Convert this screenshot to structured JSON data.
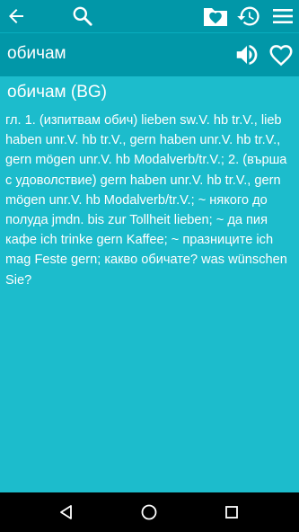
{
  "toolbar": {
    "back_icon": "arrow-left-icon",
    "search_icon": "search-icon",
    "favorites_folder_icon": "favorite-folder-icon",
    "history_icon": "history-icon",
    "menu_icon": "menu-icon"
  },
  "word_bar": {
    "title": "обичам",
    "speaker_icon": "speaker-icon",
    "favorite_icon": "heart-outline-icon"
  },
  "entry": {
    "heading": "обичам (BG)",
    "body": "гл. 1. (изпитвам обич) lieben sw.V. hb tr.V., lieb haben unr.V. hb tr.V., gern haben unr.V. hb tr.V., gern mögen unr.V. hb Modalverb/tr.V.; 2. (върша с удоволствие) gern haben unr.V. hb tr.V., gern mögen unr.V. hb Modalverb/tr.V.; ~ някого до полуда jmdn. bis zur Tollheit lieben; ~ да пия кафе ich trinke gern Kaffee; ~ празниците ich mag Feste gern; какво обичате? was wünschen Sie?"
  },
  "navbar": {
    "back_icon": "nav-back-icon",
    "home_icon": "nav-home-icon",
    "recents_icon": "nav-recents-icon"
  },
  "colors": {
    "toolbar": "#0197a8",
    "content": "#1cbccc",
    "navbar": "#000000",
    "text": "#ffffff"
  }
}
